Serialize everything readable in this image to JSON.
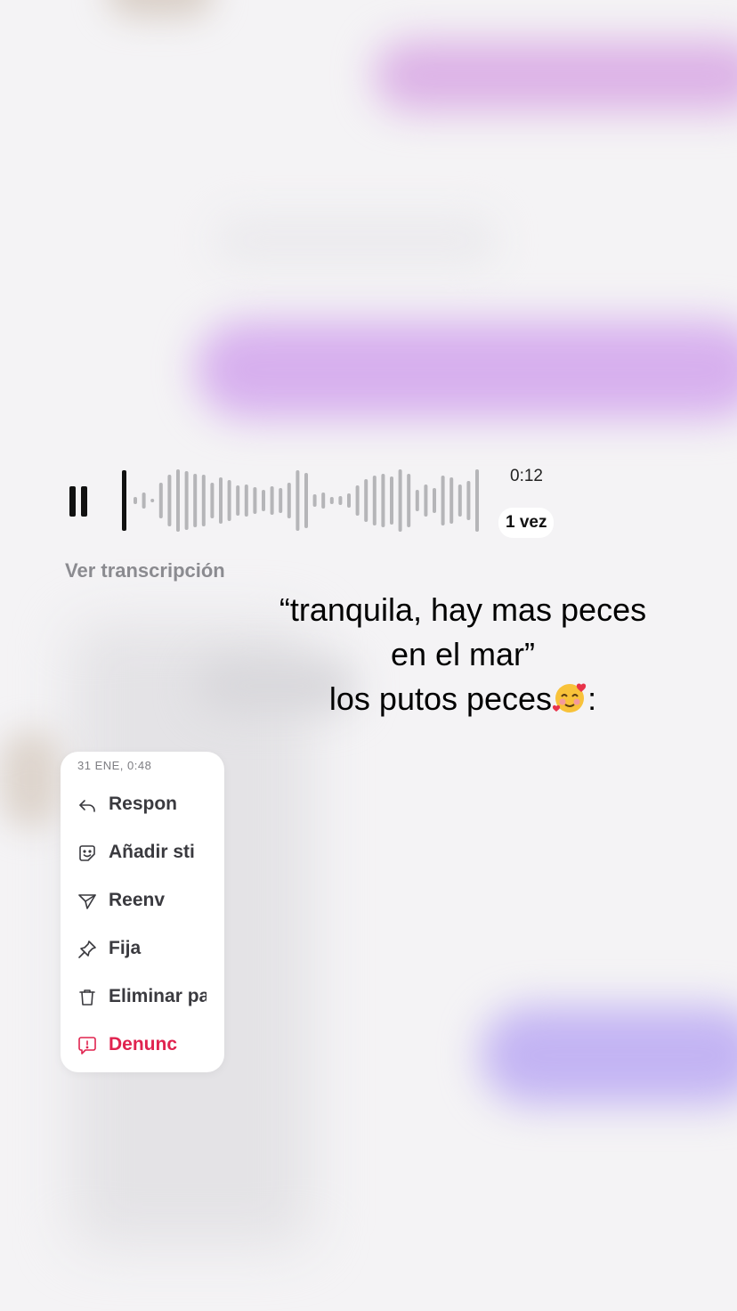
{
  "voice_message": {
    "duration": "0:12",
    "playback_speed": "1 vez",
    "transcript_link": "Ver transcripción",
    "playing": true,
    "progress": 0.0
  },
  "caption": {
    "line1": "“tranquila, hay mas peces",
    "line2": "en el mar”",
    "line3_text": "los putos peces",
    "line3_suffix": ":",
    "emoji": "smiling-face-with-hearts"
  },
  "context_menu": {
    "date": "31 ENE, 0:48",
    "items": [
      {
        "label": "Respon",
        "icon": "reply-icon"
      },
      {
        "label": "Añadir sti",
        "icon": "sticker-icon"
      },
      {
        "label": "Reenv",
        "icon": "forward-icon"
      },
      {
        "label": "Fija",
        "icon": "pin-icon"
      },
      {
        "label": "Eliminar pa",
        "icon": "trash-icon"
      },
      {
        "label": "Denunc",
        "icon": "report-icon"
      }
    ]
  },
  "colors": {
    "background": "#f4f3f5",
    "bubble_purple": "#d7b0ee",
    "danger": "#e0234f"
  }
}
